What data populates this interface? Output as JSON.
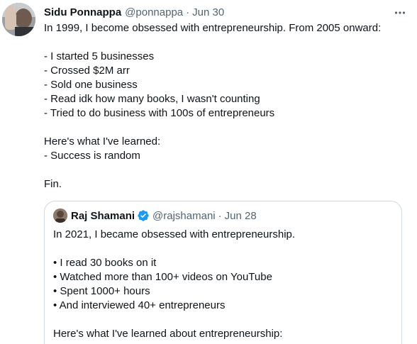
{
  "tweet": {
    "author_name": "Sidu Ponnappa",
    "author_handle": "@ponnappa",
    "separator": "·",
    "date": "Jun 30",
    "more_icon": "more-horizontal-icon",
    "lines": [
      "In 1999, I become obsessed with entrepreneurship. From 2005 onward:",
      "",
      "- I started 5 businesses",
      "- Crossed $2M arr",
      "- Sold one business",
      "- Read idk how many books, I wasn't counting",
      "- Tried to do business with 100s of entrepreneurs",
      "",
      "Here's what I've learned:",
      "- Success is random",
      "",
      "Fin."
    ]
  },
  "quoted_tweet": {
    "author_name": "Raj Shamani",
    "verified_icon": "verified-badge-icon",
    "verified_color": "#1d9bf0",
    "author_handle": "@rajshamani",
    "separator": "·",
    "date": "Jun 28",
    "lines": [
      "In 2021, I became obsessed with entrepreneurship.",
      "",
      "• I read 30 books on it",
      "• Watched more than 100+ videos on YouTube",
      "• Spent 1000+ hours",
      "• And interviewed 40+ entrepreneurs",
      "",
      "Here's what I've learned about entrepreneurship:"
    ]
  },
  "colors": {
    "text": "#0f1419",
    "secondary": "#536471",
    "border": "#cfd9de"
  }
}
